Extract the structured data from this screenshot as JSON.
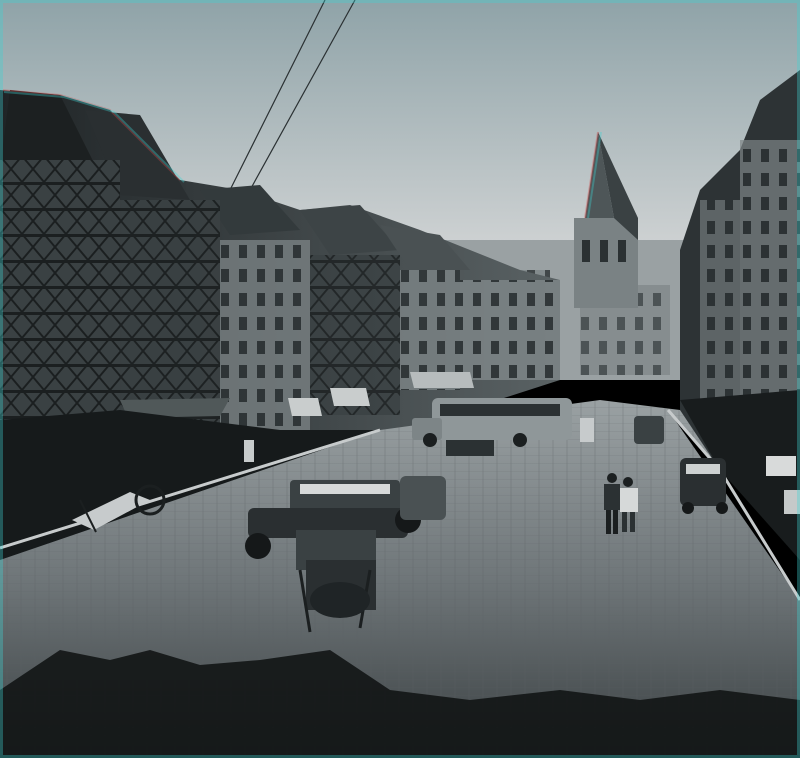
{
  "photo": {
    "subject": "anaglyph-street-scene",
    "colors": {
      "sky_top": "#8fa3a8",
      "sky_bottom": "#d9dcdc",
      "building_dark": "#2a2f31",
      "building_mid": "#4c5457",
      "building_light": "#8c9496",
      "road": "#6a7174",
      "road_far": "#9aa1a3",
      "shadow": "#121515",
      "cyan_fringe": "#3fd4d4",
      "red_fringe": "#d44848"
    }
  }
}
